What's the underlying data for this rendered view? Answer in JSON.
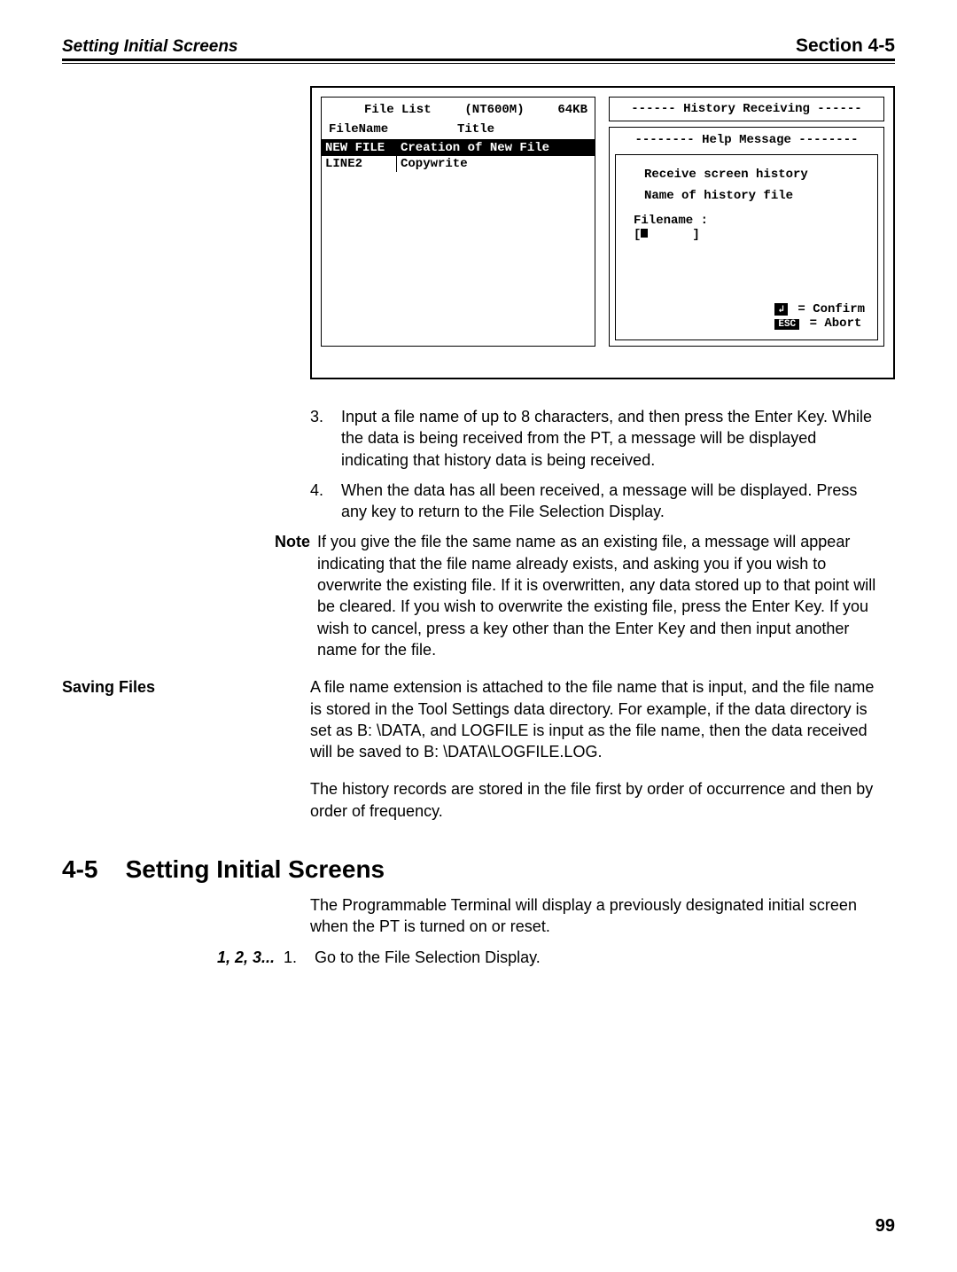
{
  "header": {
    "left": "Setting Initial Screens",
    "right": "Section 4-5"
  },
  "console": {
    "file_list_title": "File List",
    "model": "(NT600M)",
    "size": "64KB",
    "col_filename": "FileName",
    "col_title": "Title",
    "rows": [
      {
        "name": "NEW FILE",
        "title": "Creation of New File",
        "selected": true
      },
      {
        "name": "LINE2",
        "title": "Copywrite",
        "selected": false
      }
    ],
    "history_title": "------ History Receiving  ------",
    "help_title": "--------  Help Message  --------",
    "help_msg1": "Receive screen history",
    "help_msg2": "Name of history file",
    "filename_label": "Filename  :",
    "input_open": "[",
    "input_close": "]",
    "enter_key": "↲",
    "confirm": " = Confirm",
    "esc_key": "ESC",
    "abort": " = Abort"
  },
  "steps": {
    "s3": "Input a file name of up to 8 characters, and then press the Enter Key. While the data is being received from the PT, a message will be displayed indicating that history data is being received.",
    "s4": "When the data has all been received, a message will be displayed. Press any key to return to the File Selection Display."
  },
  "note": {
    "label": "Note",
    "text": "If you give the file the same name as an existing file, a message will appear indicating that the file name already exists, and asking you if you wish to overwrite the existing file. If it is overwritten, any data stored up to that point will be cleared. If you wish to overwrite the existing file, press the Enter Key. If you wish to cancel, press a key other than the Enter Key and then input another name for the file."
  },
  "saving": {
    "label": "Saving Files",
    "p1": "A file name extension is attached to the file name that is input, and the file name is stored in the Tool Settings data directory. For example, if the data directory is set as B: \\DATA, and LOGFILE is input as the file name, then the data received will be saved to B: \\DATA\\LOGFILE.LOG.",
    "p2": "The history records are stored in the file first by order of occurrence and then by order of frequency."
  },
  "section": {
    "num": "4-5",
    "title": "Setting Initial Screens",
    "body": "The Programmable Terminal will display a previously designated initial screen when the PT is turned on or reset.",
    "steps_label": "1, 2, 3...",
    "step1_num": "1.",
    "step1_text": "Go to the File Selection Display."
  },
  "page": "99"
}
